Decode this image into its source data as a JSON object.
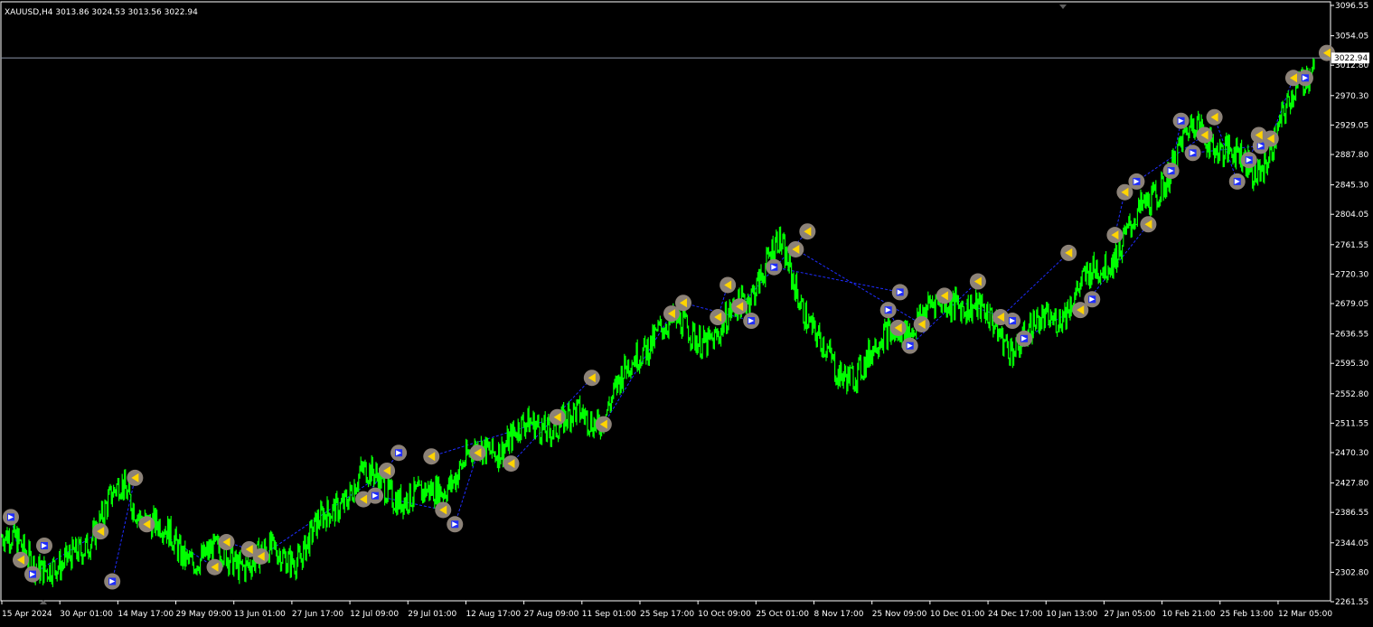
{
  "window": {
    "symbol_info": "XAUUSD,H4  3013.86 3024.53 3013.56 3022.94"
  },
  "colors": {
    "background": "#000000",
    "candles": "#00ff00",
    "axis_text": "#ffffff",
    "frame": "#ffffff",
    "bid_line": "#8a94a6",
    "trade_lines": "#1e2cff",
    "marker_halo": "#8c8278",
    "sell_arrow": "#ffd400",
    "buy_arrow": "#ffffff"
  },
  "price_axis": {
    "ticks": [
      "3096.55",
      "3054.05",
      "3012.80",
      "2970.30",
      "2929.05",
      "2887.80",
      "2845.30",
      "2804.05",
      "2761.55",
      "2720.30",
      "2679.05",
      "2636.55",
      "2595.30",
      "2552.80",
      "2511.55",
      "2470.30",
      "2427.80",
      "2386.55",
      "2344.05",
      "2302.80",
      "2261.55"
    ],
    "current_price": "3022.94"
  },
  "time_axis": {
    "ticks": [
      "15 Apr 2024",
      "30 Apr 01:00",
      "14 May 17:00",
      "29 May 09:00",
      "13 Jun 01:00",
      "27 Jun 17:00",
      "12 Jul 09:00",
      "29 Jul 01:00",
      "12 Aug 17:00",
      "27 Aug 09:00",
      "11 Sep 01:00",
      "25 Sep 17:00",
      "10 Oct 09:00",
      "25 Oct 01:00",
      "8 Nov 17:00",
      "25 Nov 09:00",
      "10 Dec 01:00",
      "24 Dec 17:00",
      "10 Jan 13:00",
      "27 Jan 05:00",
      "10 Feb 21:00",
      "25 Feb 13:00",
      "12 Mar 05:00"
    ]
  },
  "chart_data": {
    "type": "line",
    "x": [
      "15 Apr 2024",
      "30 Apr 01:00",
      "14 May 17:00",
      "29 May 09:00",
      "13 Jun 01:00",
      "27 Jun 17:00",
      "12 Jul 09:00",
      "29 Jul 01:00",
      "12 Aug 17:00",
      "27 Aug 09:00",
      "11 Sep 01:00",
      "25 Sep 17:00",
      "10 Oct 09:00",
      "25 Oct 01:00",
      "8 Nov 17:00",
      "25 Nov 09:00",
      "10 Dec 01:00",
      "24 Dec 17:00",
      "10 Jan 13:00",
      "27 Jan 05:00",
      "10 Feb 21:00",
      "25 Feb 13:00",
      "12 Mar 05:00"
    ],
    "y": [
      2350,
      2300,
      2420,
      2330,
      2320,
      2330,
      2440,
      2400,
      2470,
      2510,
      2520,
      2650,
      2630,
      2760,
      2570,
      2640,
      2690,
      2620,
      2690,
      2790,
      2930,
      2860,
      3022.94
    ],
    "ylim": [
      2261.55,
      3096.55
    ],
    "grid": false,
    "markers": [
      {
        "x": "15 Apr 2024",
        "price": 2380,
        "type": "buy"
      },
      {
        "x": "15 Apr 2024",
        "price": 2340,
        "type": "buy"
      },
      {
        "x": "15 Apr 2024",
        "price": 2300,
        "type": "buy"
      },
      {
        "x": "15 Apr 2024",
        "price": 2320,
        "type": "sell"
      },
      {
        "x": "30 Apr 01:00",
        "price": 2290,
        "type": "buy"
      },
      {
        "x": "30 Apr 01:00",
        "price": 2360,
        "type": "sell"
      },
      {
        "x": "14 May 17:00",
        "price": 2370,
        "type": "sell"
      },
      {
        "x": "14 May 17:00",
        "price": 2435,
        "type": "sell"
      },
      {
        "x": "29 May 09:00",
        "price": 2345,
        "type": "sell"
      },
      {
        "x": "29 May 09:00",
        "price": 2310,
        "type": "sell"
      },
      {
        "x": "13 Jun 01:00",
        "price": 2325,
        "type": "sell"
      },
      {
        "x": "13 Jun 01:00",
        "price": 2335,
        "type": "sell"
      },
      {
        "x": "12 Jul 09:00",
        "price": 2470,
        "type": "buy"
      },
      {
        "x": "12 Jul 09:00",
        "price": 2445,
        "type": "sell"
      },
      {
        "x": "12 Jul 09:00",
        "price": 2410,
        "type": "buy"
      },
      {
        "x": "12 Jul 09:00",
        "price": 2405,
        "type": "sell"
      },
      {
        "x": "29 Jul 01:00",
        "price": 2370,
        "type": "buy"
      },
      {
        "x": "29 Jul 01:00",
        "price": 2390,
        "type": "sell"
      },
      {
        "x": "29 Jul 01:00",
        "price": 2465,
        "type": "sell"
      },
      {
        "x": "12 Aug 17:00",
        "price": 2470,
        "type": "sell"
      },
      {
        "x": "12 Aug 17:00",
        "price": 2455,
        "type": "sell"
      },
      {
        "x": "27 Aug 09:00",
        "price": 2520,
        "type": "sell"
      },
      {
        "x": "11 Sep 01:00",
        "price": 2510,
        "type": "sell"
      },
      {
        "x": "11 Sep 01:00",
        "price": 2575,
        "type": "sell"
      },
      {
        "x": "25 Sep 17:00",
        "price": 2680,
        "type": "sell"
      },
      {
        "x": "25 Sep 17:00",
        "price": 2665,
        "type": "sell"
      },
      {
        "x": "10 Oct 09:00",
        "price": 2660,
        "type": "sell"
      },
      {
        "x": "10 Oct 09:00",
        "price": 2655,
        "type": "buy"
      },
      {
        "x": "10 Oct 09:00",
        "price": 2675,
        "type": "sell"
      },
      {
        "x": "10 Oct 09:00",
        "price": 2705,
        "type": "sell"
      },
      {
        "x": "25 Oct 01:00",
        "price": 2730,
        "type": "buy"
      },
      {
        "x": "25 Oct 01:00",
        "price": 2780,
        "type": "sell"
      },
      {
        "x": "25 Oct 01:00",
        "price": 2755,
        "type": "sell"
      },
      {
        "x": "25 Nov 09:00",
        "price": 2695,
        "type": "buy"
      },
      {
        "x": "25 Nov 09:00",
        "price": 2670,
        "type": "buy"
      },
      {
        "x": "25 Nov 09:00",
        "price": 2650,
        "type": "sell"
      },
      {
        "x": "25 Nov 09:00",
        "price": 2620,
        "type": "buy"
      },
      {
        "x": "25 Nov 09:00",
        "price": 2645,
        "type": "sell"
      },
      {
        "x": "10 Dec 01:00",
        "price": 2690,
        "type": "sell"
      },
      {
        "x": "10 Dec 01:00",
        "price": 2710,
        "type": "sell"
      },
      {
        "x": "24 Dec 17:00",
        "price": 2630,
        "type": "buy"
      },
      {
        "x": "24 Dec 17:00",
        "price": 2655,
        "type": "buy"
      },
      {
        "x": "24 Dec 17:00",
        "price": 2660,
        "type": "sell"
      },
      {
        "x": "10 Jan 13:00",
        "price": 2685,
        "type": "buy"
      },
      {
        "x": "10 Jan 13:00",
        "price": 2670,
        "type": "sell"
      },
      {
        "x": "10 Jan 13:00",
        "price": 2750,
        "type": "sell"
      },
      {
        "x": "27 Jan 05:00",
        "price": 2775,
        "type": "sell"
      },
      {
        "x": "27 Jan 05:00",
        "price": 2790,
        "type": "sell"
      },
      {
        "x": "27 Jan 05:00",
        "price": 2850,
        "type": "buy"
      },
      {
        "x": "27 Jan 05:00",
        "price": 2835,
        "type": "sell"
      },
      {
        "x": "10 Feb 21:00",
        "price": 2865,
        "type": "buy"
      },
      {
        "x": "10 Feb 21:00",
        "price": 2915,
        "type": "sell"
      },
      {
        "x": "10 Feb 21:00",
        "price": 2890,
        "type": "buy"
      },
      {
        "x": "10 Feb 21:00",
        "price": 2935,
        "type": "buy"
      },
      {
        "x": "10 Feb 21:00",
        "price": 2940,
        "type": "sell"
      },
      {
        "x": "25 Feb 13:00",
        "price": 2900,
        "type": "buy"
      },
      {
        "x": "25 Feb 13:00",
        "price": 2880,
        "type": "buy"
      },
      {
        "x": "25 Feb 13:00",
        "price": 2850,
        "type": "buy"
      },
      {
        "x": "25 Feb 13:00",
        "price": 2910,
        "type": "sell"
      },
      {
        "x": "25 Feb 13:00",
        "price": 2915,
        "type": "sell"
      },
      {
        "x": "12 Mar 05:00",
        "price": 2995,
        "type": "buy"
      },
      {
        "x": "12 Mar 05:00",
        "price": 2995,
        "type": "sell"
      },
      {
        "x": "12 Mar 05:00",
        "price": 3030,
        "type": "sell"
      }
    ]
  }
}
